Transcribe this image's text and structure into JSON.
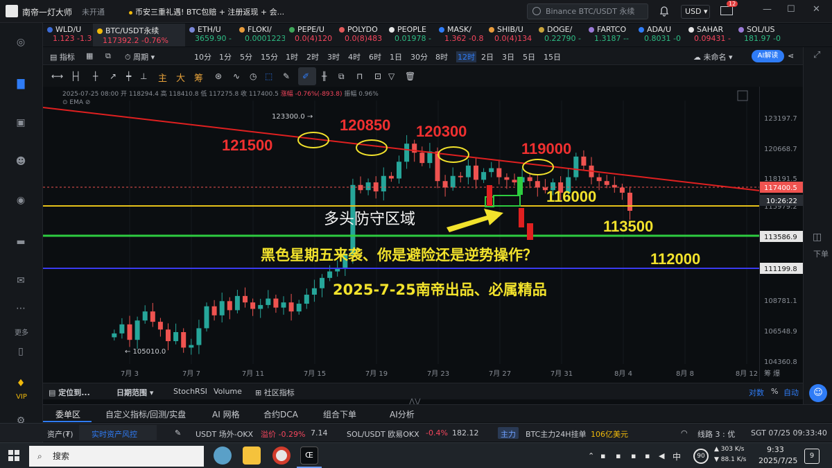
{
  "titlebar": {
    "app_name": "南帝一灯大师",
    "status": "未开通",
    "marquee": "币安三重礼遇! BTC包赔 + 注册返现 + 会...",
    "search_placeholder": "Binance BTC/USDT 永续",
    "currency": "USD",
    "mail_badge": "12"
  },
  "tickers": [
    {
      "sym": "WLD/U",
      "val": "1.123 -1.3",
      "dir": "dn",
      "color": "#3b6bd6"
    },
    {
      "sym": "BTC/USDT永续",
      "val": "117392.2 -0.76%",
      "dir": "dn",
      "color": "#f0b90b",
      "active": true
    },
    {
      "sym": "ETH/U",
      "val": "3659.90 -",
      "dir": "up",
      "color": "#7a86d6"
    },
    {
      "sym": "FLOKI/",
      "val": "0.0001223",
      "dir": "up",
      "color": "#e89b3c"
    },
    {
      "sym": "PEPE/U",
      "val": "0.0(4)120",
      "dir": "dn",
      "color": "#3fa55a"
    },
    {
      "sym": "POLYDO",
      "val": "0.0(8)483",
      "dir": "dn",
      "color": "#e05a5a"
    },
    {
      "sym": "PEOPLE",
      "val": "0.01978 -",
      "dir": "up",
      "color": "#e6e6e6"
    },
    {
      "sym": "MASK/",
      "val": "1.362 -0.8",
      "dir": "dn",
      "color": "#2f7cf6"
    },
    {
      "sym": "SHIB/U",
      "val": "0.0(4)134",
      "dir": "dn",
      "color": "#e89b3c"
    },
    {
      "sym": "DOGE/",
      "val": "0.22790 -",
      "dir": "up",
      "color": "#c9a43c"
    },
    {
      "sym": "FARTCO",
      "val": "1.3187 --",
      "dir": "up",
      "color": "#9a7ad6"
    },
    {
      "sym": "ADA/U",
      "val": "0.8031 -0",
      "dir": "up",
      "color": "#2f7cf6"
    },
    {
      "sym": "SAHAR",
      "val": "0.09431 -",
      "dir": "dn",
      "color": "#e6e6e6"
    },
    {
      "sym": "SOL/US",
      "val": "181.97 -0",
      "dir": "up",
      "color": "#9a7ad6"
    }
  ],
  "sidebar": {
    "more": "更多",
    "vip": "VIP"
  },
  "toolbar": {
    "indicator": "指标",
    "period": "周期",
    "intervals": [
      "10分",
      "1分",
      "5分",
      "15分",
      "1时",
      "2时",
      "3时",
      "4时",
      "6时",
      "1日",
      "30分",
      "8时",
      "12时",
      "2日",
      "3日",
      "5日",
      "15日"
    ],
    "active_interval": "12时",
    "layout_name": "未命名",
    "ai_button": "AI解读"
  },
  "drawing": {
    "main": "主",
    "big": "大",
    "chip": "筹"
  },
  "infobar": {
    "datetime": "2025-07-25 08:00",
    "open": "开 118294.4",
    "high": "高 118410.8",
    "low": "低 117275.8",
    "close": "收 117400.5",
    "change": "涨幅 -0.76%(-893.8)",
    "amp": "振幅 0.96%",
    "ema": "EMA"
  },
  "chart_data": {
    "type": "candlestick",
    "x_ticks": [
      "7月 3",
      "7月 7",
      "7月 11",
      "7月 15",
      "7月 19",
      "7月 23",
      "7月 27",
      "7月 31",
      "8月 4",
      "8月 8",
      "8月 12"
    ],
    "y_ticks": [
      "123197.7",
      "120668.7",
      "118191.5",
      "113586.9",
      "111199.8",
      "108781.1",
      "106548.9",
      "104360.8"
    ],
    "price_label": "117400.5",
    "countdown": "10:26:22",
    "hidden_label": "115979.2",
    "high_marker": "123300.0",
    "low_marker": "105010.0",
    "levels": [
      {
        "label": "116000",
        "value": 116000,
        "color": "#e6c21a"
      },
      {
        "label": "113500",
        "value": 113500,
        "color": "#2ecc40"
      },
      {
        "label": "112000",
        "value": 111199.8,
        "color": "#3a3af0"
      }
    ],
    "resistance_peaks": [
      "121500",
      "120850",
      "120300",
      "119000"
    ],
    "annotations": {
      "zone": "多头防守区域",
      "question": "黑色星期五来袭、你是避险还是逆势操作？",
      "signature": "2025-7-25南帝出品、必属精品"
    }
  },
  "strip": {
    "locate": "定位到...",
    "date_range": "日期范围",
    "stoch": "StochRSI",
    "volume": "Volume",
    "community": "社区指标",
    "log": "对数",
    "pct": "%",
    "auto": "自动"
  },
  "tabs": [
    "委单区",
    "自定义指标/回测/实盘",
    "AI 网格",
    "合约DCA",
    "组合下单",
    "AI分析"
  ],
  "status": {
    "assets": "资产(₮)",
    "realtime": "实时资产风控",
    "otc": "USDT 场外-OKX",
    "premium": "溢价 -0.29%",
    "premium_val": "7.14",
    "sol": "SOL/USDT 欧易OKX",
    "sol_chg": "-0.4%",
    "sol_px": "182.12",
    "main": "主力",
    "btc_main": "BTC主力24H挂单",
    "btc_main_val": "106亿美元",
    "line": "线路 3 : 优",
    "time": "SGT 07/25 09:33:40"
  },
  "taskbar": {
    "search": "搜索",
    "upload": "303 K/s",
    "download": "88.1 K/s",
    "ime": "中",
    "temp": "90",
    "clock": "9:33",
    "date": "2025/7/25",
    "notif": "9"
  }
}
